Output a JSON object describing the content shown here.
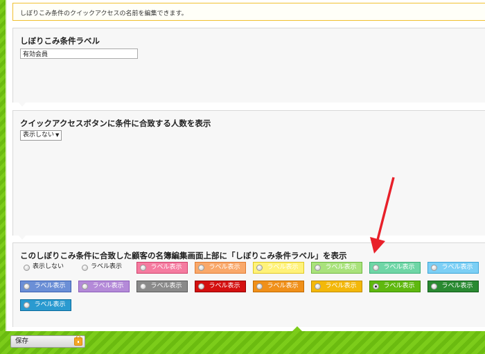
{
  "notice": "しぼりこみ条件のクイックアクセスの名前を編集できます。",
  "label_section": {
    "title": "しぼりこみ条件ラベル",
    "input_value": "有効会員"
  },
  "count_section": {
    "title": "クイックアクセスボタンに条件に合致する人数を表示",
    "select_value": "表示しない",
    "select_arrow": "▼"
  },
  "display_section": {
    "title": "このしぼりこみ条件に合致した顧客の名簿編集画面上部に「しぼりこみ条件ラベル」を表示",
    "options": [
      {
        "label": "表示しない",
        "bg": "transparent",
        "border": "transparent",
        "style": "plain",
        "checked": false
      },
      {
        "label": "ラベル表示",
        "bg": "transparent",
        "border": "transparent",
        "style": "plain",
        "checked": false
      },
      {
        "label": "ラベル表示",
        "bg": "#f57ba0",
        "border": "#d0406a",
        "checked": false
      },
      {
        "label": "ラベル表示",
        "bg": "#f9a86a",
        "border": "#e07a30",
        "checked": false
      },
      {
        "label": "ラベル表示",
        "bg": "#fff27a",
        "border": "#e0c820",
        "checked": false
      },
      {
        "label": "ラベル表示",
        "bg": "#a9e27c",
        "border": "#70b840",
        "checked": false
      },
      {
        "label": "ラベル表示",
        "bg": "#6fd6a6",
        "border": "#3aae7a",
        "checked": false
      },
      {
        "label": "ラベル表示",
        "bg": "#7ccff5",
        "border": "#3aa4d8",
        "checked": false
      },
      {
        "label": "ラベル表示",
        "bg": "#6b8fd6",
        "border": "#3a5fb0",
        "checked": false
      },
      {
        "label": "ラベル表示",
        "bg": "#b48ad8",
        "border": "#8a5cb8",
        "checked": false
      },
      {
        "label": "ラベル表示",
        "bg": "#8a8a8a",
        "border": "#5a5a5a",
        "checked": false
      },
      {
        "label": "ラベル表示",
        "bg": "#d41010",
        "border": "#900000",
        "checked": false
      },
      {
        "label": "ラベル表示",
        "bg": "#f0901a",
        "border": "#c06a00",
        "checked": false
      },
      {
        "label": "ラベル表示",
        "bg": "#f3b80a",
        "border": "#c08a00",
        "checked": false
      },
      {
        "label": "ラベル表示",
        "bg": "#5fb80f",
        "border": "#3a8a00",
        "checked": true
      },
      {
        "label": "ラベル表示",
        "bg": "#2a8a32",
        "border": "#0f5a18",
        "checked": false
      },
      {
        "label": "ラベル表示",
        "bg": "#2a9ad0",
        "border": "#0a6a9a",
        "checked": false
      }
    ]
  },
  "footer": {
    "save_label": "保存"
  },
  "annotation": {
    "arrow_color": "#e8202a"
  }
}
